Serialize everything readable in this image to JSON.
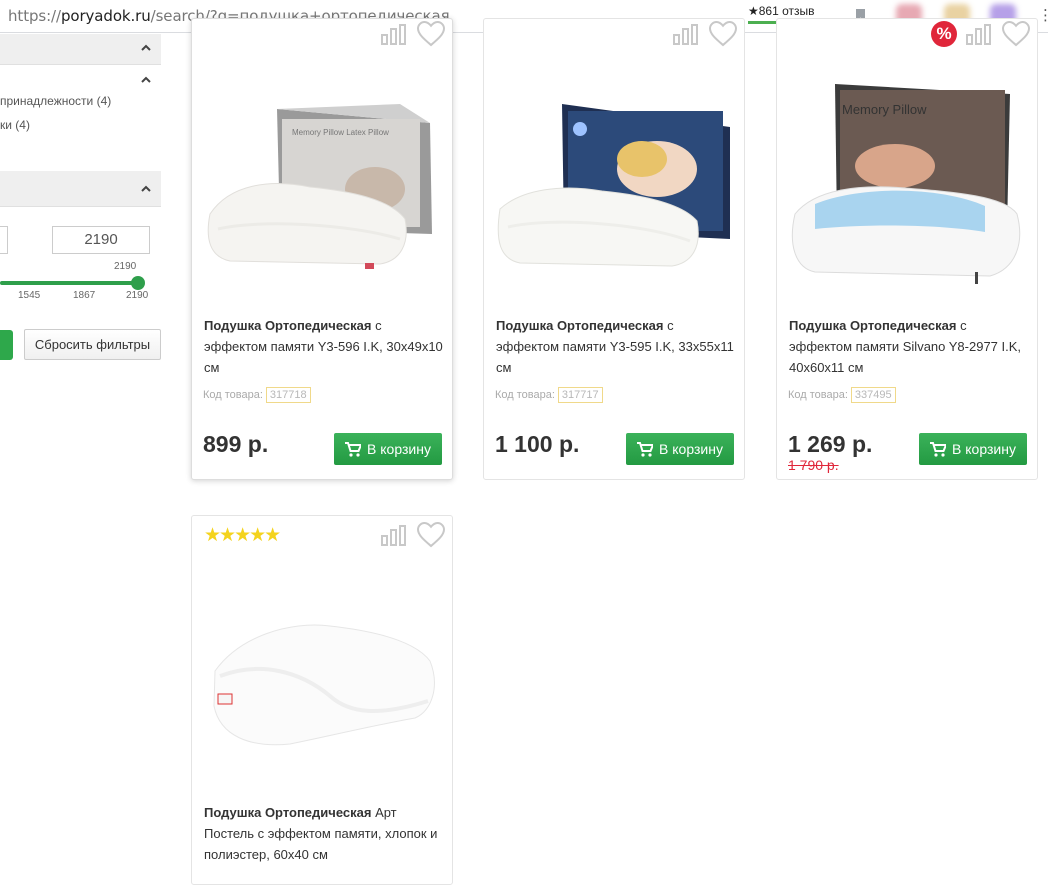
{
  "browser": {
    "url_prefix": "https://",
    "url_host": "poryadok.ru",
    "url_path": "/search/?q=подушка+ортопедическая",
    "reviews_label": "★861 отзыв"
  },
  "sidebar": {
    "items": [
      "принадлежности (4)",
      "ки (4)"
    ],
    "price_from": "",
    "price_to": "2190",
    "slider_max_label": "2190",
    "ticks": [
      "1545",
      "1867",
      "2190"
    ],
    "reset_label": "Сбросить фильтры"
  },
  "products": [
    {
      "title_bold": "Подушка Ортопедическая",
      "title_rest": " с эффектом памяти Y3-596 I.K, 30x49x10 см",
      "code_label": "Код товара:",
      "code": "317718",
      "price": "899 р.",
      "old_price": "",
      "cart_label": "В корзину"
    },
    {
      "title_bold": "Подушка Ортопедическая",
      "title_rest": " с эффектом памяти Y3-595 I.K, 33x55x11 см",
      "code_label": "Код товара:",
      "code": "317717",
      "price": "1 100 р.",
      "old_price": "",
      "cart_label": "В корзину"
    },
    {
      "title_bold": "Подушка Ортопедическая",
      "title_rest": " с эффектом памяти Silvano Y8-2977 I.K, 40x60x11 см",
      "code_label": "Код товара:",
      "code": "337495",
      "price": "1 269 р.",
      "old_price": "1 790 р.",
      "cart_label": "В корзину",
      "sale_badge": "%"
    },
    {
      "title_bold": "Подушка Ортопедическая",
      "title_rest": " Арт Постель с эффектом памяти, хлопок и полиэстер, 60x40 см",
      "stars": "★★★★★",
      "rating": 5
    }
  ],
  "box_texts": {
    "p1": "Memory Pillow Latex Pillow",
    "p3": "Memory Pillow"
  },
  "colors": {
    "accent_green": "#2ea84b",
    "sale_red": "#e0263a",
    "star_yellow": "#f4d31d"
  }
}
